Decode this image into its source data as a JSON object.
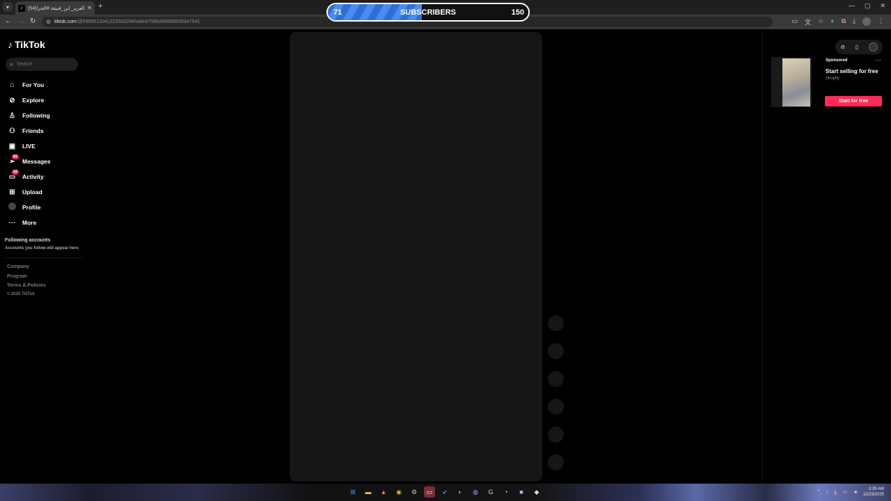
{
  "browser": {
    "tab_title": "(54)عبدالعزيز_ابن_قنيفة #الجزا",
    "new_tab": "+",
    "url_host": "tiktok.com",
    "url_path": "/@6950613041222583298/video/7585489008935947541"
  },
  "overlay": {
    "current": "71",
    "label": "SUBSCRIBERS",
    "goal": "150",
    "progress_fraction": 0.47
  },
  "sidebar": {
    "logo_text": "TikTok",
    "search_placeholder": "Search",
    "items": [
      {
        "label": "For You",
        "icon": "home-icon"
      },
      {
        "label": "Explore",
        "icon": "compass-icon"
      },
      {
        "label": "Following",
        "icon": "user-follow-icon"
      },
      {
        "label": "Friends",
        "icon": "friends-icon"
      },
      {
        "label": "LIVE",
        "icon": "live-icon"
      },
      {
        "label": "Messages",
        "icon": "paper-plane-icon",
        "badge": "41"
      },
      {
        "label": "Activity",
        "icon": "inbox-icon",
        "badge": "19"
      },
      {
        "label": "Upload",
        "icon": "plus-square-icon"
      },
      {
        "label": "Profile",
        "icon": "avatar"
      },
      {
        "label": "More",
        "icon": "more-icon"
      }
    ],
    "following_title": "Following accounts",
    "following_sub": "Accounts you follow will appear here",
    "footer": [
      "Company",
      "Program",
      "Terms & Policies",
      "© 2025 TikTok"
    ]
  },
  "ad": {
    "sponsored": "Sponsored",
    "title": "Start selling for free",
    "brand": "Shopify",
    "cta": "Start for free"
  },
  "taskbar": {
    "time": "2:35 AM",
    "date": "12/23/2025"
  },
  "colors": {
    "accent": "#fe2c55",
    "overlay_fill": "#2e6fd6",
    "video_bg": "#161616"
  }
}
